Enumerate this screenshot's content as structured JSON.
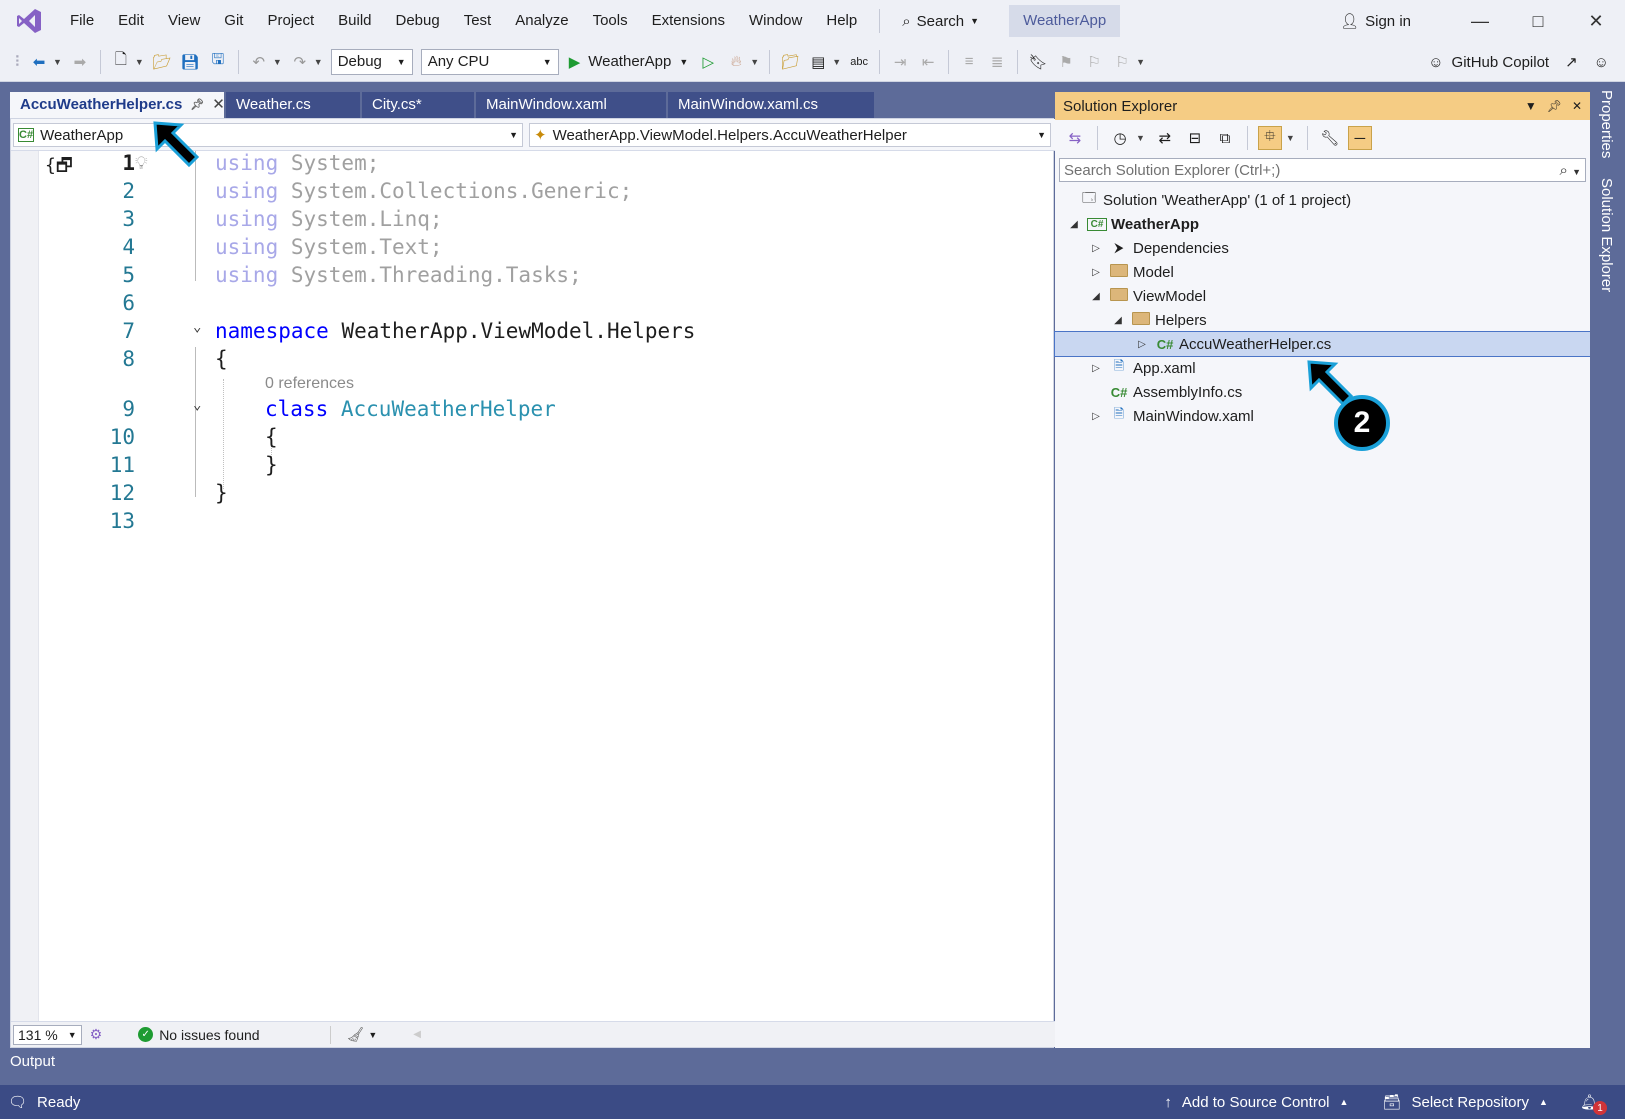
{
  "menu": {
    "items": [
      "File",
      "Edit",
      "View",
      "Git",
      "Project",
      "Build",
      "Debug",
      "Test",
      "Analyze",
      "Tools",
      "Extensions",
      "Window",
      "Help"
    ],
    "search_label": "Search",
    "solution_title": "WeatherApp",
    "sign_in": "Sign in"
  },
  "toolbar": {
    "config": "Debug",
    "platform": "Any CPU",
    "run_target": "WeatherApp",
    "copilot": "GitHub Copilot"
  },
  "tabs": [
    {
      "label": "AccuWeatherHelper.cs",
      "active": true
    },
    {
      "label": "Weather.cs",
      "active": false
    },
    {
      "label": "City.cs*",
      "active": false
    },
    {
      "label": "MainWindow.xaml",
      "active": false
    },
    {
      "label": "MainWindow.xaml.cs",
      "active": false
    }
  ],
  "editor": {
    "project_combo": "WeatherApp",
    "member_combo": "WeatherApp.ViewModel.Helpers.AccuWeatherHelper",
    "lines": [
      {
        "n": "1",
        "text": "using System;"
      },
      {
        "n": "2",
        "text": "using System.Collections.Generic;"
      },
      {
        "n": "3",
        "text": "using System.Linq;"
      },
      {
        "n": "4",
        "text": "using System.Text;"
      },
      {
        "n": "5",
        "text": "using System.Threading.Tasks;"
      },
      {
        "n": "6",
        "text": ""
      },
      {
        "n": "7",
        "text": "namespace WeatherApp.ViewModel.Helpers"
      },
      {
        "n": "8",
        "text": "{"
      },
      {
        "n": "9",
        "text": "class AccuWeatherHelper"
      },
      {
        "n": "10",
        "text": "{"
      },
      {
        "n": "11",
        "text": "}"
      },
      {
        "n": "12",
        "text": "}"
      },
      {
        "n": "13",
        "text": ""
      }
    ],
    "codelens": "0 references",
    "zoom": "131 %",
    "issues": "No issues found"
  },
  "solution_explorer": {
    "title": "Solution Explorer",
    "search_placeholder": "Search Solution Explorer (Ctrl+;)",
    "tree": [
      {
        "label": "Solution 'WeatherApp' (1 of 1 project)"
      },
      {
        "label": "WeatherApp"
      },
      {
        "label": "Dependencies"
      },
      {
        "label": "Model"
      },
      {
        "label": "ViewModel"
      },
      {
        "label": "Helpers"
      },
      {
        "label": "AccuWeatherHelper.cs"
      },
      {
        "label": "App.xaml"
      },
      {
        "label": "AssemblyInfo.cs"
      },
      {
        "label": "MainWindow.xaml"
      }
    ]
  },
  "side_rail": {
    "properties": "Properties",
    "solution_explorer": "Solution Explorer"
  },
  "output_tab": "Output",
  "status": {
    "ready": "Ready",
    "add_source": "Add to Source Control",
    "select_repo": "Select Repository",
    "notif_count": "1"
  },
  "callout": {
    "number": "2"
  },
  "colors": {
    "accent": "#5d6b99",
    "status_bar": "#3b4b85",
    "panel_header": "#f5cc84",
    "selection": "#c9d7f1",
    "callout_ring": "#1aa0d8"
  }
}
